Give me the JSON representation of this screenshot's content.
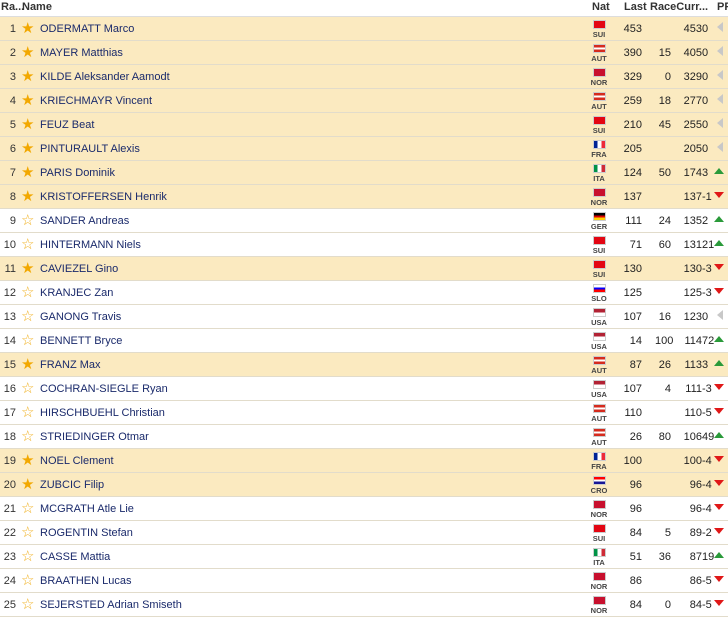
{
  "header": {
    "rank": "Ra...",
    "name": "Name",
    "nat": "Nat",
    "last": "Last",
    "racecurr": "RaceCurr...",
    "pf": "PF"
  },
  "rows": [
    {
      "rank": "1",
      "name": "ODERMATT Marco",
      "nat": "SUI",
      "last": "453",
      "race": "",
      "curr": "453",
      "pf": "0",
      "trend": "same",
      "fav": true
    },
    {
      "rank": "2",
      "name": "MAYER Matthias",
      "nat": "AUT",
      "last": "390",
      "race": "15",
      "curr": "405",
      "pf": "0",
      "trend": "same",
      "fav": true
    },
    {
      "rank": "3",
      "name": "KILDE Aleksander Aamodt",
      "nat": "NOR",
      "last": "329",
      "race": "0",
      "curr": "329",
      "pf": "0",
      "trend": "same",
      "fav": true
    },
    {
      "rank": "4",
      "name": "KRIECHMAYR Vincent",
      "nat": "AUT",
      "last": "259",
      "race": "18",
      "curr": "277",
      "pf": "0",
      "trend": "same",
      "fav": true
    },
    {
      "rank": "5",
      "name": "FEUZ Beat",
      "nat": "SUI",
      "last": "210",
      "race": "45",
      "curr": "255",
      "pf": "0",
      "trend": "same",
      "fav": true
    },
    {
      "rank": "6",
      "name": "PINTURAULT Alexis",
      "nat": "FRA",
      "last": "205",
      "race": "",
      "curr": "205",
      "pf": "0",
      "trend": "same",
      "fav": true
    },
    {
      "rank": "7",
      "name": "PARIS Dominik",
      "nat": "ITA",
      "last": "124",
      "race": "50",
      "curr": "174",
      "pf": "3",
      "trend": "up",
      "fav": true
    },
    {
      "rank": "8",
      "name": "KRISTOFFERSEN Henrik",
      "nat": "NOR",
      "last": "137",
      "race": "",
      "curr": "137",
      "pf": "-1",
      "trend": "down",
      "fav": true
    },
    {
      "rank": "9",
      "name": "SANDER Andreas",
      "nat": "GER",
      "last": "111",
      "race": "24",
      "curr": "135",
      "pf": "2",
      "trend": "up",
      "fav": false
    },
    {
      "rank": "10",
      "name": "HINTERMANN Niels",
      "nat": "SUI",
      "last": "71",
      "race": "60",
      "curr": "131",
      "pf": "21",
      "trend": "up",
      "fav": false
    },
    {
      "rank": "11",
      "name": "CAVIEZEL Gino",
      "nat": "SUI",
      "last": "130",
      "race": "",
      "curr": "130",
      "pf": "-3",
      "trend": "down",
      "fav": true
    },
    {
      "rank": "12",
      "name": "KRANJEC Zan",
      "nat": "SLO",
      "last": "125",
      "race": "",
      "curr": "125",
      "pf": "-3",
      "trend": "down",
      "fav": false
    },
    {
      "rank": "13",
      "name": "GANONG Travis",
      "nat": "USA",
      "last": "107",
      "race": "16",
      "curr": "123",
      "pf": "0",
      "trend": "same",
      "fav": false
    },
    {
      "rank": "14",
      "name": "BENNETT Bryce",
      "nat": "USA",
      "last": "14",
      "race": "100",
      "curr": "114",
      "pf": "72",
      "trend": "up",
      "fav": false
    },
    {
      "rank": "15",
      "name": "FRANZ Max",
      "nat": "AUT",
      "last": "87",
      "race": "26",
      "curr": "113",
      "pf": "3",
      "trend": "up",
      "fav": true
    },
    {
      "rank": "16",
      "name": "COCHRAN-SIEGLE Ryan",
      "nat": "USA",
      "last": "107",
      "race": "4",
      "curr": "111",
      "pf": "-3",
      "trend": "down",
      "fav": false
    },
    {
      "rank": "17",
      "name": "HIRSCHBUEHL Christian",
      "nat": "AUT",
      "last": "110",
      "race": "",
      "curr": "110",
      "pf": "-5",
      "trend": "down",
      "fav": false
    },
    {
      "rank": "18",
      "name": "STRIEDINGER Otmar",
      "nat": "AUT",
      "last": "26",
      "race": "80",
      "curr": "106",
      "pf": "49",
      "trend": "up",
      "fav": false
    },
    {
      "rank": "19",
      "name": "NOEL Clement",
      "nat": "FRA",
      "last": "100",
      "race": "",
      "curr": "100",
      "pf": "-4",
      "trend": "down",
      "fav": true
    },
    {
      "rank": "20",
      "name": "ZUBCIC Filip",
      "nat": "CRO",
      "last": "96",
      "race": "",
      "curr": "96",
      "pf": "-4",
      "trend": "down",
      "fav": true
    },
    {
      "rank": "21",
      "name": "MCGRATH Atle Lie",
      "nat": "NOR",
      "last": "96",
      "race": "",
      "curr": "96",
      "pf": "-4",
      "trend": "down",
      "fav": false
    },
    {
      "rank": "22",
      "name": "ROGENTIN Stefan",
      "nat": "SUI",
      "last": "84",
      "race": "5",
      "curr": "89",
      "pf": "-2",
      "trend": "down",
      "fav": false
    },
    {
      "rank": "23",
      "name": "CASSE Mattia",
      "nat": "ITA",
      "last": "51",
      "race": "36",
      "curr": "87",
      "pf": "19",
      "trend": "up",
      "fav": false
    },
    {
      "rank": "24",
      "name": "BRAATHEN Lucas",
      "nat": "NOR",
      "last": "86",
      "race": "",
      "curr": "86",
      "pf": "-5",
      "trend": "down",
      "fav": false
    },
    {
      "rank": "25",
      "name": "SEJERSTED Adrian Smiseth",
      "nat": "NOR",
      "last": "84",
      "race": "0",
      "curr": "84",
      "pf": "-5",
      "trend": "down",
      "fav": false
    }
  ],
  "flags": {
    "SUI": {
      "bg": "#e30613",
      "icon": "swiss-flag-icon"
    },
    "AUT": {
      "bg": "linear-gradient(#d52b1e 33%, #ffffff 33%, #ffffff 67%, #d52b1e 67%)",
      "icon": "austrian-flag-icon"
    },
    "NOR": {
      "bg": "#c8102e",
      "icon": "norwegian-flag-icon"
    },
    "FRA": {
      "bg": "linear-gradient(90deg, #002395 33%, #ffffff 33%, #ffffff 67%, #ed2939 67%)",
      "icon": "french-flag-icon"
    },
    "ITA": {
      "bg": "linear-gradient(90deg, #009246 33%, #ffffff 33%, #ffffff 67%, #ce2b37 67%)",
      "icon": "italian-flag-icon"
    },
    "GER": {
      "bg": "linear-gradient(#000000 33%, #dd0000 33%, #dd0000 67%, #ffce00 67%)",
      "icon": "german-flag-icon"
    },
    "SLO": {
      "bg": "linear-gradient(#ffffff 33%, #0000ff 33%, #0000ff 67%, #ff0000 67%)",
      "icon": "slovenian-flag-icon"
    },
    "USA": {
      "bg": "linear-gradient(#b22234 50%, #ffffff 50%)",
      "icon": "usa-flag-icon"
    },
    "CRO": {
      "bg": "linear-gradient(#ff0000 33%, #ffffff 33%, #ffffff 67%, #171796 67%)",
      "icon": "croatian-flag-icon"
    }
  },
  "colors": {
    "favorite_row": "#fbeac0",
    "name_text": "#1a2a6b",
    "trend_up": "#2a9a3a",
    "trend_down": "#e01818",
    "trend_same": "#c8c8c8",
    "star": "#f2a800"
  }
}
